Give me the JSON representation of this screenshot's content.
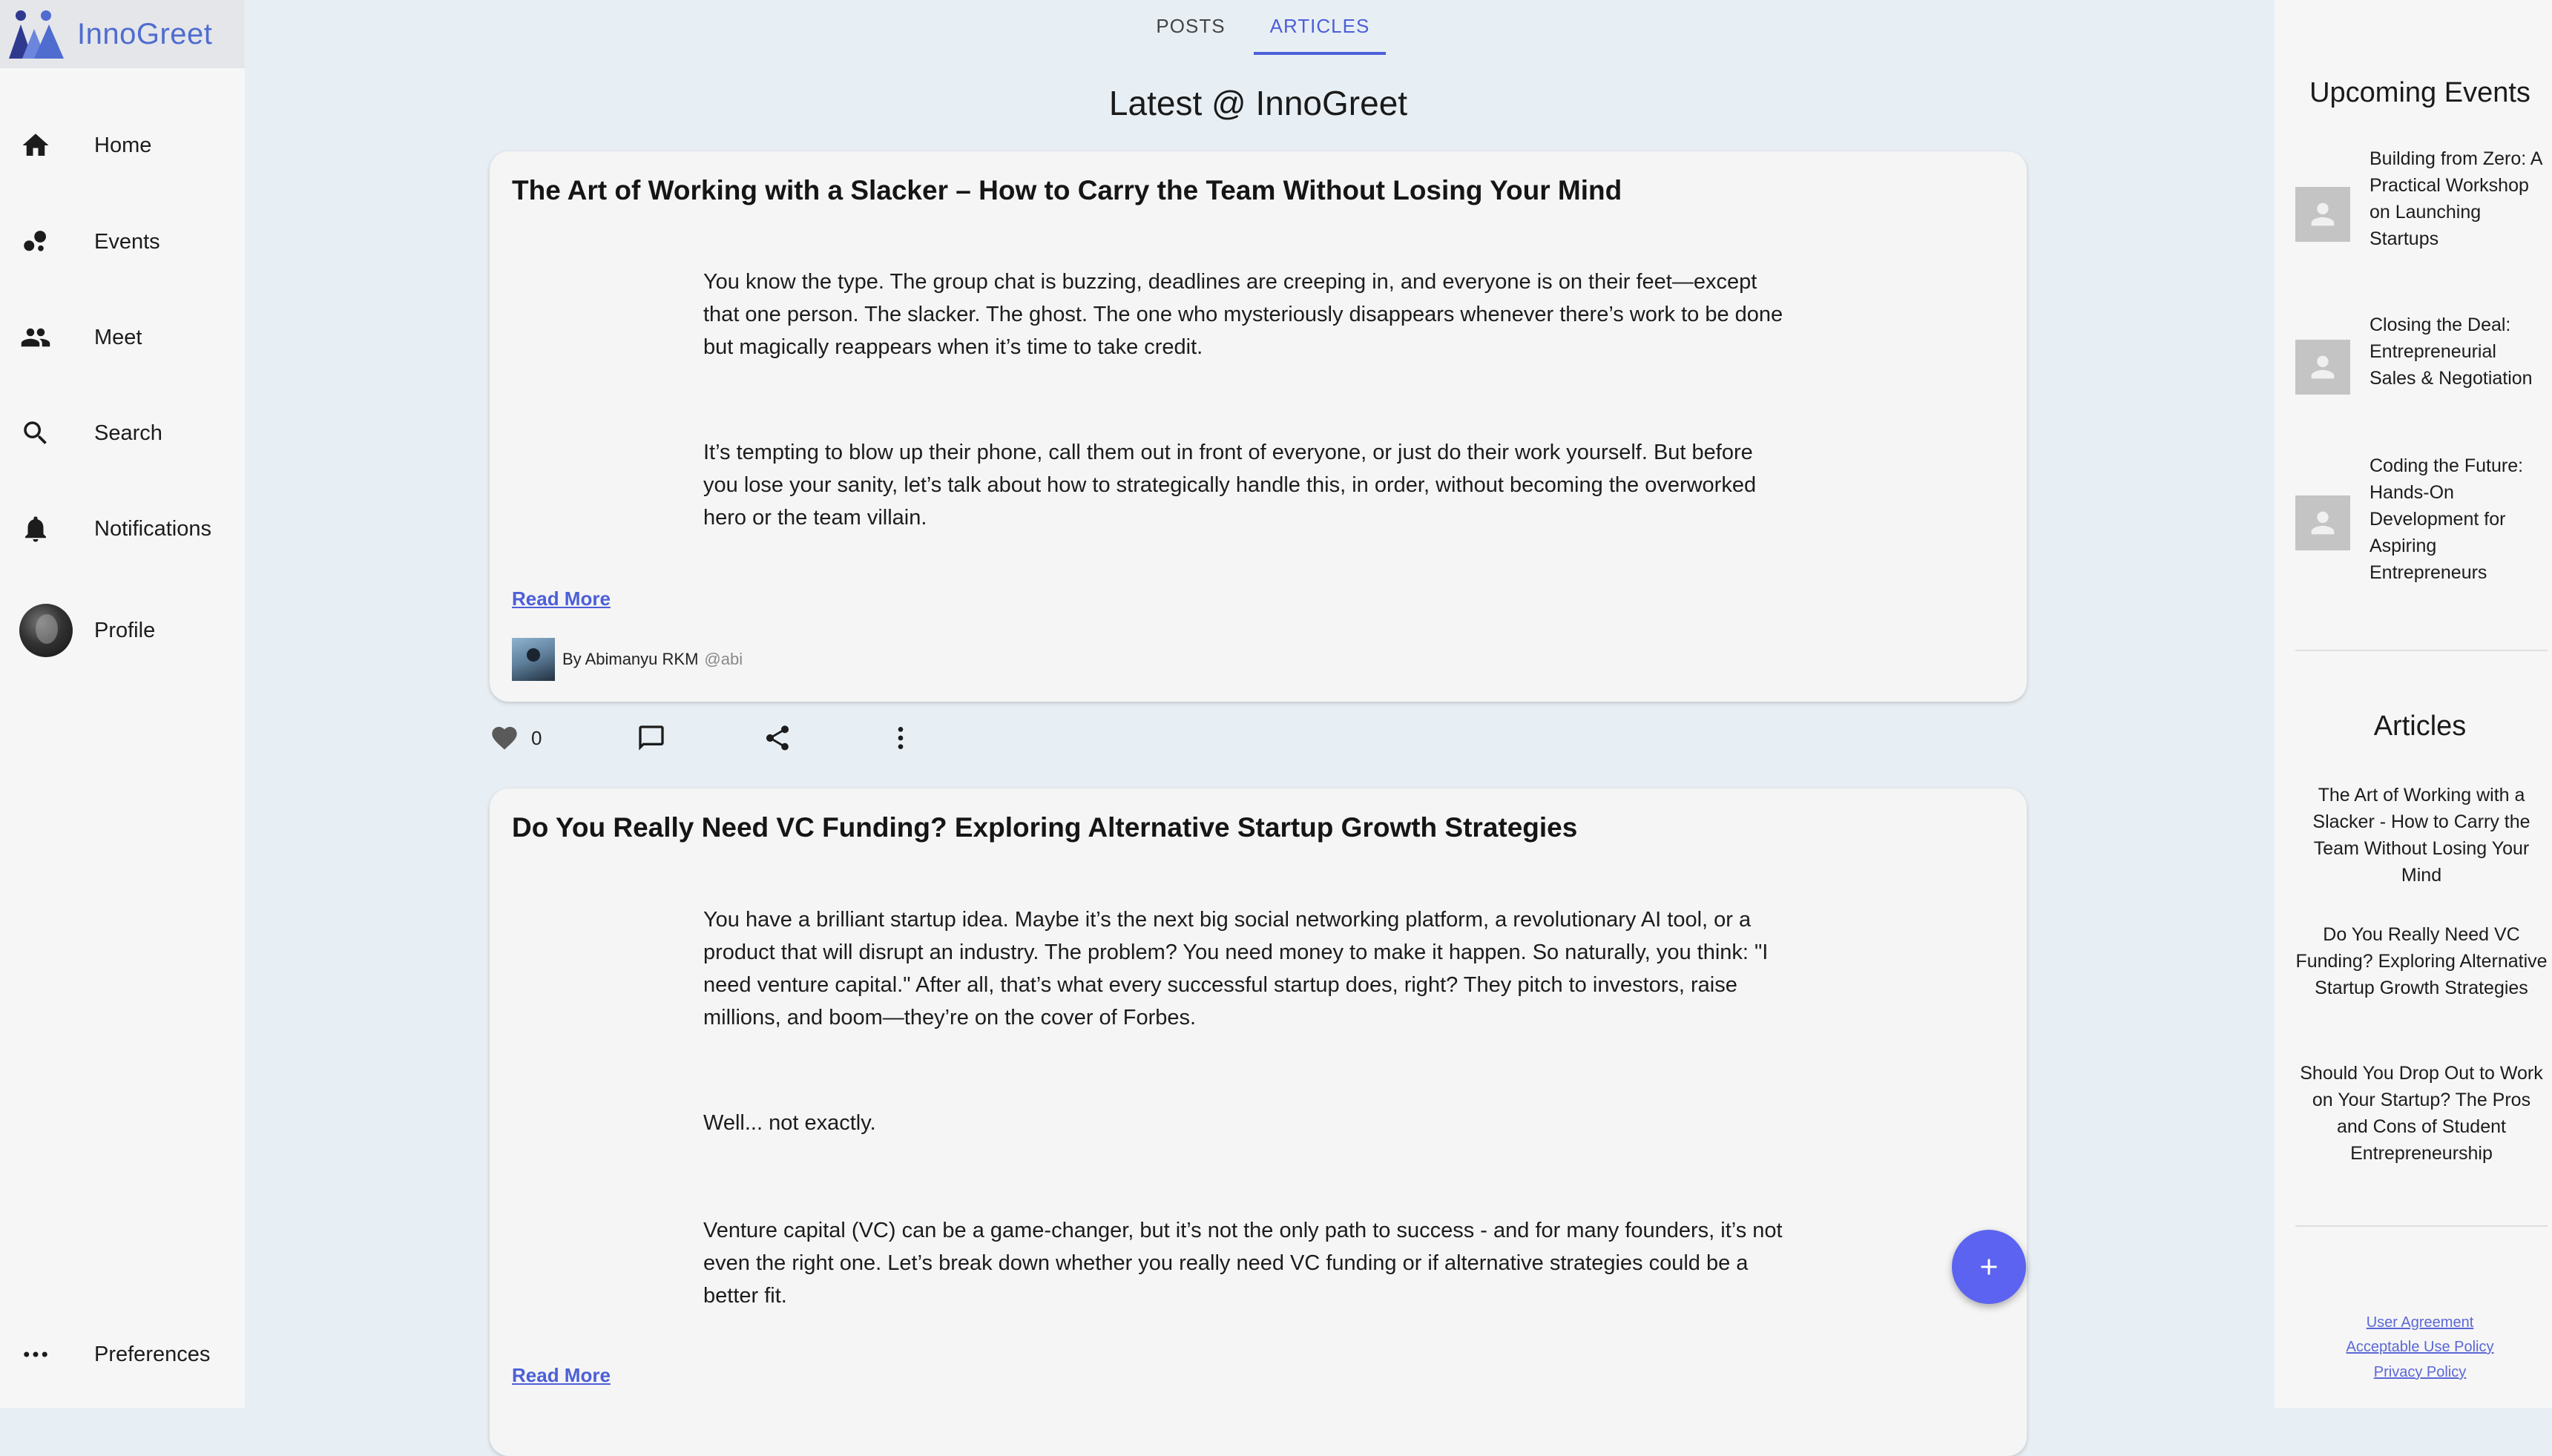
{
  "brand": {
    "name": "InnoGreet"
  },
  "nav": {
    "home": "Home",
    "events": "Events",
    "meet": "Meet",
    "search": "Search",
    "notifications": "Notifications",
    "profile": "Profile",
    "preferences": "Preferences"
  },
  "tabs": {
    "posts": "POSTS",
    "articles": "ARTICLES",
    "active": "ARTICLES"
  },
  "feed": {
    "title": "Latest @ InnoGreet"
  },
  "articles": [
    {
      "title": "The Art of Working with a Slacker – How to Carry the Team Without Losing Your Mind",
      "paragraphs": [
        "You know the type. The group chat is buzzing, deadlines are creeping in, and everyone is on their feet—except that one person. The slacker. The ghost. The one who mysteriously disappears whenever there’s work to be done but magically reappears when it’s time to take credit.",
        "It’s tempting to blow up their phone, call them out in front of everyone, or just do their work yourself. But before you lose your sanity, let’s talk about how to strategically handle this, in order, without becoming the overworked hero or the team villain."
      ],
      "read_more": "Read More",
      "author": "By Abimanyu RKM",
      "handle": "@abi",
      "likes": "0"
    },
    {
      "title": "Do You Really Need VC Funding? Exploring Alternative Startup Growth Strategies",
      "paragraphs": [
        "You have a brilliant startup idea. Maybe it’s the next big social networking platform, a revolutionary AI tool, or a product that will disrupt an industry. The problem? You need money to make it happen. So naturally, you think: \"I need venture capital.\" After all, that’s what every successful startup does, right? They pitch to investors, raise millions, and boom—they’re on the cover of Forbes.",
        "Well... not exactly.",
        "Venture capital (VC) can be a game-changer, but it’s not the only path to success - and for many founders, it’s not even the right one. Let’s break down whether you really need VC funding or if alternative strategies could be a better fit."
      ],
      "read_more": "Read More"
    }
  ],
  "right_panel": {
    "events_heading": "Upcoming Events",
    "events": [
      "Building from Zero: A Practical Workshop on Launching Startups",
      "Closing the Deal: Entrepreneurial Sales & Negotiation",
      "Coding the Future: Hands-On Development for Aspiring Entrepreneurs"
    ],
    "articles_heading": "Articles",
    "articles": [
      "The Art of Working with a Slacker - How to Carry the Team Without Losing Your Mind",
      "Do You Really Need VC Funding? Exploring Alternative Startup Growth Strategies",
      "Should You Drop Out to Work on Your Startup? The Pros and Cons of Student Entrepreneurship"
    ],
    "legal": [
      "User Agreement",
      "Acceptable Use Policy",
      "Privacy Policy"
    ]
  },
  "colors": {
    "accent": "#4c5fd8",
    "fab": "#5b63f0",
    "logo": "#4f6ccf",
    "background": "#e8eff4"
  },
  "icons": {
    "home": "home-icon",
    "events": "bubbles-icon",
    "meet": "people-icon",
    "search": "search-icon",
    "notifications": "bell-icon",
    "preferences": "more-horizontal-icon",
    "like": "heart-icon",
    "comment": "comment-icon",
    "share": "share-icon",
    "more": "more-vertical-icon",
    "fab": "plus-icon"
  }
}
